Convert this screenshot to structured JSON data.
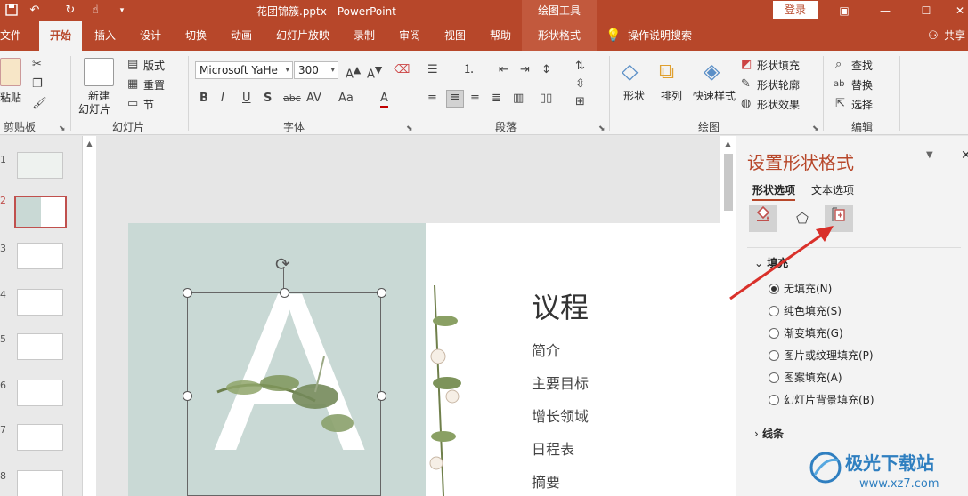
{
  "titlebar": {
    "doc_title": "花团锦簇.pptx  -  PowerPoint",
    "context_title": "绘图工具",
    "login_label": "登录",
    "icons": [
      "save-icon",
      "undo-icon",
      "redo-icon",
      "touch-mode-icon",
      "customize-qat-icon"
    ],
    "window_controls": [
      "ribbon-display-icon",
      "minimize-icon",
      "maximize-icon",
      "close-icon"
    ]
  },
  "tabs": [
    "文件",
    "开始",
    "插入",
    "设计",
    "切换",
    "动画",
    "幻灯片放映",
    "录制",
    "审阅",
    "视图",
    "帮助",
    "形状格式"
  ],
  "active_tab": "开始",
  "tell_me": "操作说明搜索",
  "share_label": "共享",
  "ribbon": {
    "clipboard": {
      "paste": "粘贴",
      "group": "剪贴板"
    },
    "slides": {
      "new_slide_line1": "新建",
      "new_slide_line2": "幻灯片",
      "layout": "版式",
      "reset": "重置",
      "section": "节",
      "group": "幻灯片"
    },
    "font": {
      "font_name": "Microsoft YaHe",
      "font_size": "300",
      "group": "字体",
      "buttons": [
        "B",
        "I",
        "U",
        "S",
        "abc",
        "AV",
        "Aa",
        "A"
      ]
    },
    "paragraph": {
      "group": "段落"
    },
    "drawing": {
      "shapes": "形状",
      "arrange": "排列",
      "quick_styles": "快速样式",
      "fill": "形状填充",
      "outline": "形状轮廓",
      "effects": "形状效果",
      "group": "绘图"
    },
    "editing": {
      "find": "查找",
      "replace": "替换",
      "select": "选择",
      "group": "编辑"
    }
  },
  "thumbnails": {
    "numbers": [
      "1",
      "2",
      "3",
      "4",
      "5",
      "6",
      "7",
      "8"
    ],
    "selected": "2"
  },
  "slide": {
    "big_letter": "A",
    "agenda_title": "议程",
    "agenda_items": [
      "简介",
      "主要目标",
      "增长领域",
      "日程表",
      "摘要"
    ]
  },
  "format_pane": {
    "title": "设置形状格式",
    "tab_shape": "形状选项",
    "tab_text": "文本选项",
    "icon_buttons": [
      "fill-line-icon",
      "effects-pentagon-icon",
      "size-properties-icon"
    ],
    "fill_section": "填充",
    "fill_options": [
      "无填充(N)",
      "纯色填充(S)",
      "渐变填充(G)",
      "图片或纹理填充(P)",
      "图案填充(A)",
      "幻灯片背景填充(B)"
    ],
    "fill_selected": "无填充(N)",
    "line_section": "线条"
  },
  "watermark": {
    "text": "极光下载站",
    "url": "www.xz7.com"
  },
  "colors": {
    "accent": "#b7472a",
    "context_tab": "#c2593d",
    "arrow": "#d9302a",
    "slide_bg_left": "#c9d9d5"
  }
}
